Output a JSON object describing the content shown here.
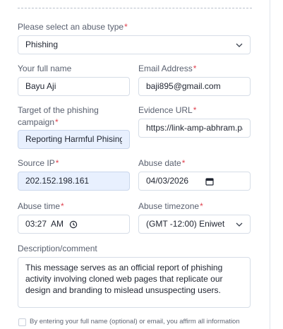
{
  "form": {
    "abuse_type": {
      "label": "Please select an abuse type",
      "required_mark": "*",
      "value": "Phishing",
      "icon": "chevron-down-icon"
    },
    "full_name": {
      "label": "Your full name",
      "value": "Bayu Aji"
    },
    "email": {
      "label": "Email Address",
      "required_mark": "*",
      "value": "baji895@gmail.com"
    },
    "target": {
      "label": "Target of the phishing campaign",
      "required_mark": "*",
      "value": "Reporting Harmful Phising L"
    },
    "evidence_url": {
      "label": "Evidence URL",
      "required_mark": "*",
      "value": "https://link-amp-abhram.pa"
    },
    "source_ip": {
      "label": "Source IP",
      "required_mark": "*",
      "value": "202.152.198.161"
    },
    "abuse_date": {
      "label": "Abuse date",
      "required_mark": "*",
      "value": "04/03/2026",
      "icon": "calendar-icon"
    },
    "abuse_time": {
      "label": "Abuse time",
      "required_mark": "*",
      "value": "03:27  AM",
      "icon": "clock-icon"
    },
    "abuse_timezone": {
      "label": "Abuse timezone",
      "required_mark": "*",
      "value": "(GMT -12:00) Eniwet",
      "icon": "chevron-down-icon"
    },
    "description": {
      "label": "Description/comment",
      "value": "This message serves as an official report of phishing activity involving cloned web pages that replicate our design and branding to mislead unsuspecting users."
    },
    "consent": {
      "text": "By entering your full name (optional) or email, you affirm all information",
      "checked": false
    }
  },
  "colors": {
    "required": "#e0424f",
    "autofill_background": "#e8f0fe",
    "border": "#d6dde7"
  }
}
